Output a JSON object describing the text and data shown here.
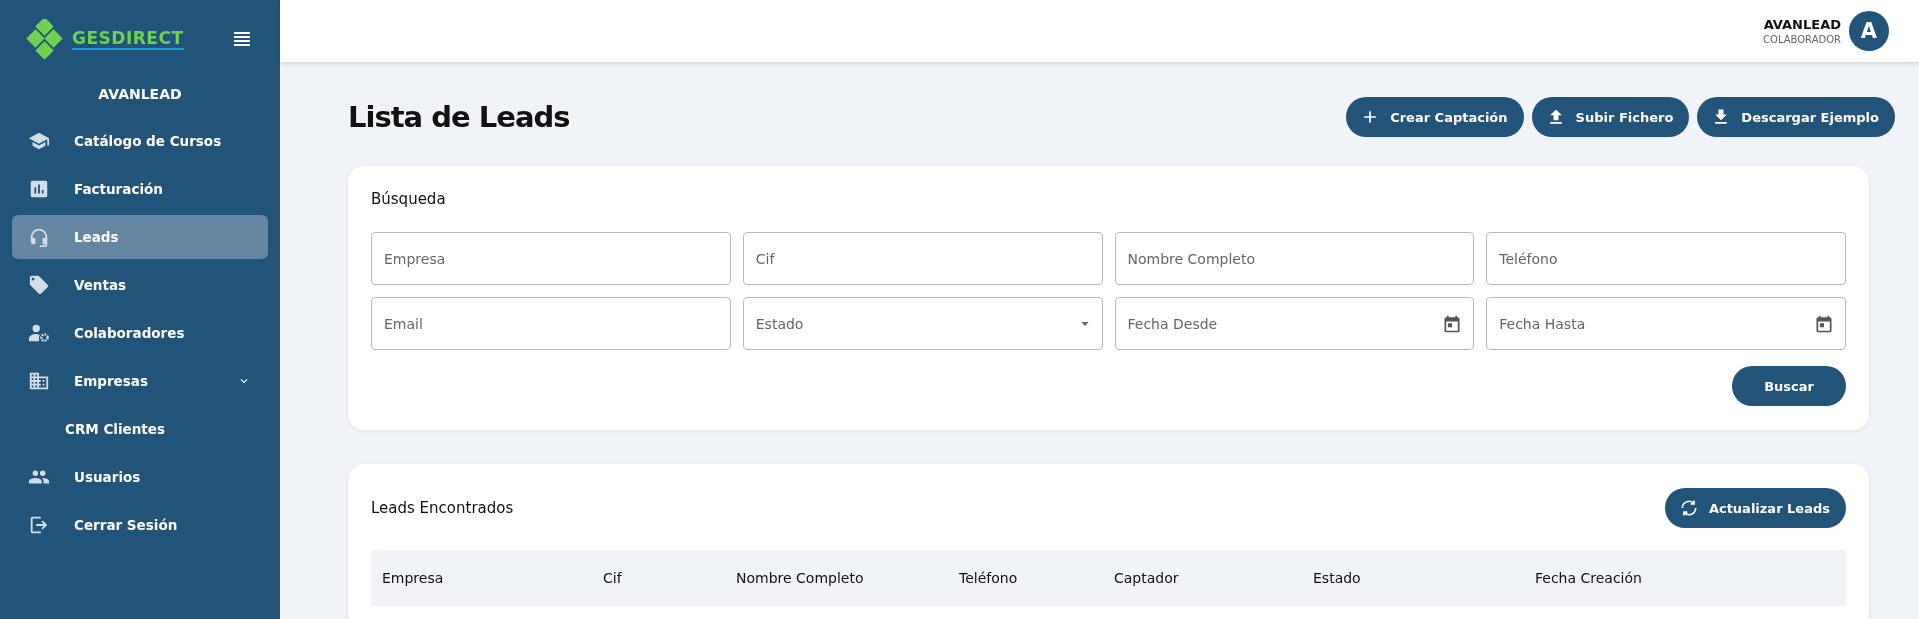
{
  "sidebar": {
    "logo": "GESDIRECT",
    "company": "AVANLEAD",
    "items": [
      {
        "label": "Catálogo de Cursos",
        "selected": false,
        "kind": "item"
      },
      {
        "label": "Facturación",
        "selected": false,
        "kind": "item"
      },
      {
        "label": "Leads",
        "selected": true,
        "kind": "item"
      },
      {
        "label": "Ventas",
        "selected": false,
        "kind": "item"
      },
      {
        "label": "Colaboradores",
        "selected": false,
        "kind": "item"
      },
      {
        "label": "Empresas",
        "selected": false,
        "kind": "group",
        "expanded": true
      },
      {
        "label": "CRM Clientes",
        "selected": false,
        "kind": "subitem"
      },
      {
        "label": "Usuarios",
        "selected": false,
        "kind": "item"
      },
      {
        "label": "Cerrar Sesión",
        "selected": false,
        "kind": "item"
      }
    ]
  },
  "header": {
    "user_name": "AVANLEAD",
    "user_role": "COLABORADOR",
    "avatar": "A"
  },
  "page": {
    "title": "Lista de Leads",
    "actions": [
      {
        "label": "Crear Captación"
      },
      {
        "label": "Subir Fichero"
      },
      {
        "label": "Descargar Ejemplo"
      }
    ]
  },
  "search": {
    "title": "Búsqueda",
    "fields": [
      {
        "placeholder": "Empresa",
        "kind": "text"
      },
      {
        "placeholder": "Cif",
        "kind": "text"
      },
      {
        "placeholder": "Nombre Completo",
        "kind": "text"
      },
      {
        "placeholder": "Teléfono",
        "kind": "text"
      },
      {
        "placeholder": "Email",
        "kind": "text"
      },
      {
        "placeholder": "Estado",
        "kind": "select"
      },
      {
        "placeholder": "Fecha Desde",
        "kind": "date"
      },
      {
        "placeholder": "Fecha Hasta",
        "kind": "date"
      }
    ],
    "button": "Buscar"
  },
  "results": {
    "title": "Leads Encontrados",
    "button": "Actualizar Leads",
    "table": {
      "columns": [
        "Empresa",
        "Cif",
        "Nombre Completo",
        "Teléfono",
        "Captador",
        "Estado",
        "Fecha Creación"
      ]
    }
  }
}
